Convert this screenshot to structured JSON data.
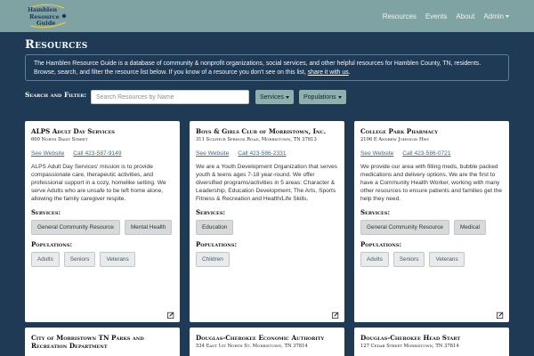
{
  "navbar": {
    "logo_text": [
      "Hamblen",
      "Resource",
      "Guide"
    ],
    "links": [
      "Resources",
      "Events",
      "About",
      "Admin"
    ]
  },
  "header": {
    "title": "Resources",
    "intro_text": "The Hamblen Resource Guide is a database of community & nonprofit organizations, social services, and other helpful resources for Hamblen County, TN, residents. Browse, search, and filter the resource list below. If you know of a resource you don't see on this list,",
    "intro_link": "share it with us",
    "intro_end": "."
  },
  "filters": {
    "label": "Search and Filter:",
    "search_placeholder": "Search Resources by Name",
    "services_label": "Services",
    "populations_label": "Populations"
  },
  "cards": [
    {
      "title": "ALPS Adult Day Services",
      "address": "600 North Daisy Street",
      "website": "See Website",
      "phone": "Call 423-587-9149",
      "description": "ALPS Adult Day Services' mission is to provide compassionate care, therapeutic activities, and professional support in a cozy, homelike setting. We serve Adults who are unsafe to be left home alone, allowing the family caregiver respite.",
      "services_label": "Services:",
      "services": [
        "General Community Resource",
        "Mental Health"
      ],
      "populations_label": "Populations:",
      "populations": [
        "Adults",
        "Seniors",
        "Veterans"
      ]
    },
    {
      "title": "Boys & Girls Club of Morristown, Inc.",
      "address": "311 Sulphur Springs Road, Morristown, TN 37813",
      "website": "See Website",
      "phone": "Call 423-586-2331",
      "description": "We are a Youth Development Organization that serves youth & teens ages 7-18 year-round. We offer diversified programs/activities in 5 areas: Character & Leadership, Education Development, The Arts, Sports Fitness & Recreation and Health/Life Skills.",
      "services_label": "Services:",
      "services": [
        "Education"
      ],
      "populations_label": "Populations:",
      "populations": [
        "Children"
      ]
    },
    {
      "title": "College Park Pharmacy",
      "address": "2106 E Andrew Johnson Hwy",
      "website": "See Website",
      "phone": "Call 423-586-0721",
      "description": "We provide our area with filling meds, bubble packed medications and delivery options. We are the first to have a Community Health Worker, working with many other resources to ensure patients and families get the help they need.",
      "services_label": "Services:",
      "services": [
        "General Community Resource",
        "Medical"
      ],
      "populations_label": "Populations:",
      "populations": [
        "Adults",
        "Seniors",
        "Veterans"
      ]
    },
    {
      "title": "City of Morristown TN Parks and Recreation Department",
      "address": "",
      "website": "",
      "phone": "",
      "description": "",
      "services_label": "",
      "services": [],
      "populations_label": "",
      "populations": []
    },
    {
      "title": "Douglas-Cherokee Economic Authority",
      "address": "534 East 1st North St. Morristown, TN 37814",
      "website": "",
      "phone": "",
      "description": "",
      "services_label": "",
      "services": [],
      "populations_label": "",
      "populations": []
    },
    {
      "title": "Douglas-Cherokee Head Start",
      "address": "127 Cedar Street Morristown, TN 37814",
      "website": "",
      "phone": "",
      "description": "",
      "services_label": "",
      "services": [],
      "populations_label": "",
      "populations": []
    }
  ],
  "colors": {
    "page_bg": "#1e3a55",
    "navbar_bg": "#7fa3a3",
    "button_bg": "#8fb0ad",
    "link": "#3a6a8c"
  },
  "icons": [
    "edit-icon",
    "caret-down-icon"
  ]
}
